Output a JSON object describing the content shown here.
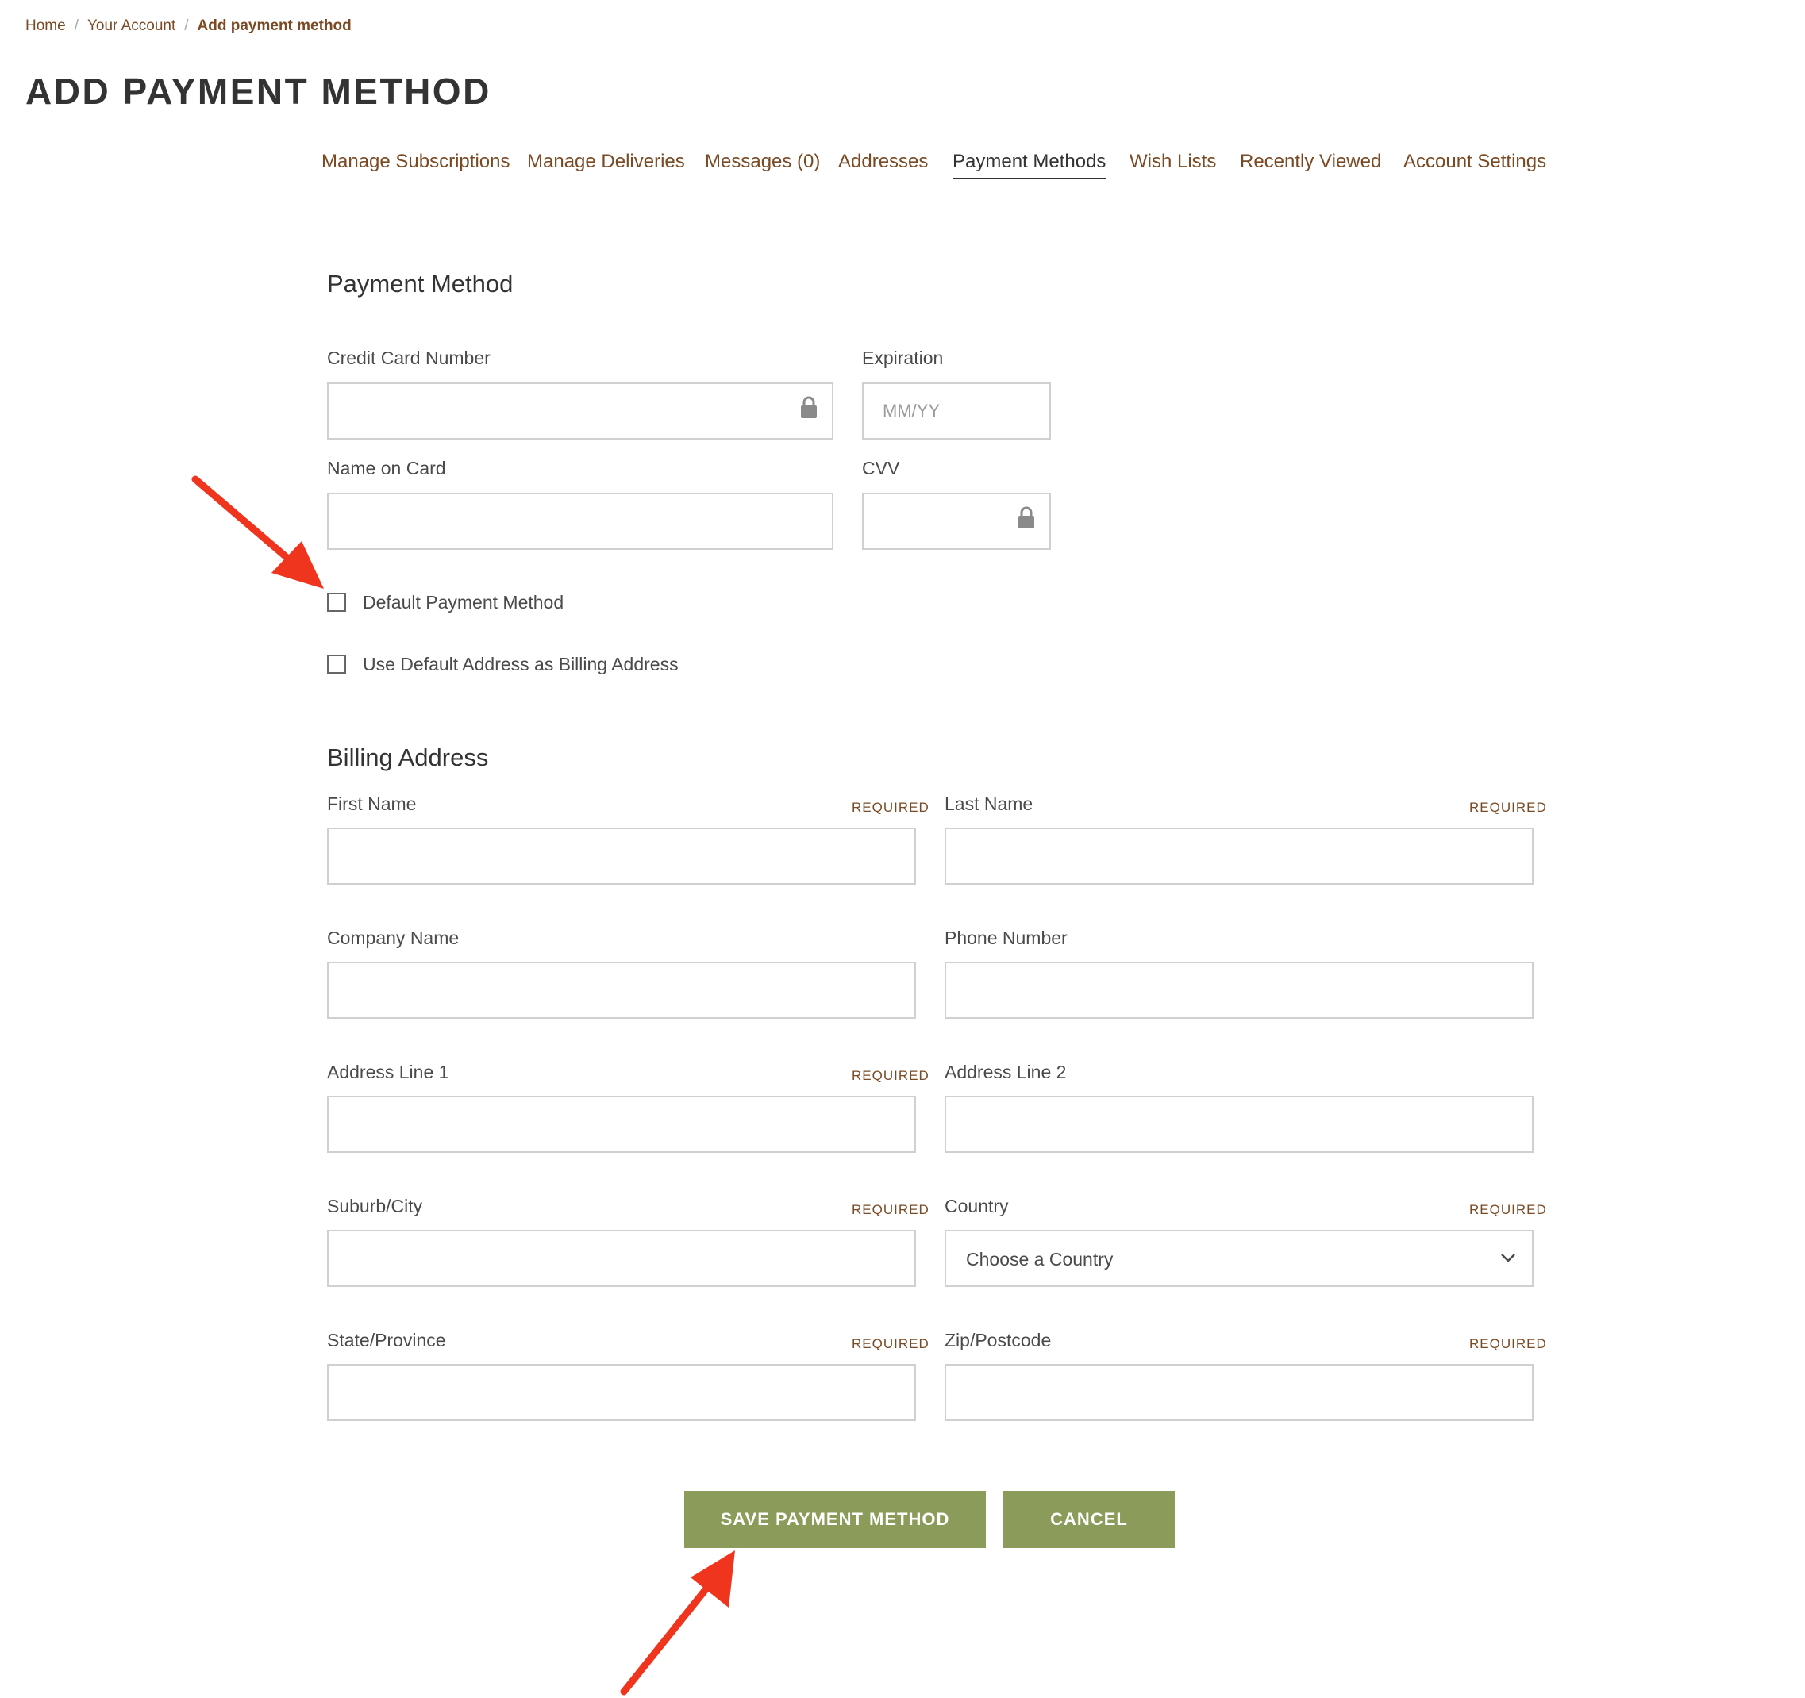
{
  "breadcrumb": {
    "home": "Home",
    "account": "Your Account",
    "current": "Add payment method",
    "separator": "/"
  },
  "page_title": "ADD PAYMENT METHOD",
  "nav": {
    "items": [
      {
        "label": "Manage Subscriptions"
      },
      {
        "label": "Manage Deliveries"
      },
      {
        "label": "Messages (0)"
      },
      {
        "label": "Addresses"
      },
      {
        "label": "Payment Methods",
        "active": true
      },
      {
        "label": "Wish Lists"
      },
      {
        "label": "Recently Viewed"
      },
      {
        "label": "Account Settings"
      }
    ]
  },
  "payment": {
    "title": "Payment Method",
    "card_number_label": "Credit Card Number",
    "card_number_value": "",
    "expiration_label": "Expiration",
    "expiration_placeholder": "MM/YY",
    "name_label": "Name on Card",
    "name_value": "",
    "cvv_label": "CVV",
    "cvv_value": "",
    "default_payment_label": "Default Payment Method",
    "default_payment_checked": false,
    "use_default_address_label": "Use Default Address as Billing Address",
    "use_default_address_checked": false
  },
  "billing": {
    "title": "Billing Address",
    "required_text": "REQUIRED",
    "first_name_label": "First Name",
    "last_name_label": "Last Name",
    "company_label": "Company Name",
    "phone_label": "Phone Number",
    "address1_label": "Address Line 1",
    "address2_label": "Address Line 2",
    "city_label": "Suburb/City",
    "country_label": "Country",
    "country_selected": "Choose a Country",
    "state_label": "State/Province",
    "zip_label": "Zip/Postcode"
  },
  "buttons": {
    "save": "SAVE PAYMENT METHOD",
    "cancel": "CANCEL"
  },
  "colors": {
    "accent_brown": "#7a4a24",
    "button_green": "#8b9c5a",
    "annotation_red": "#f0351f"
  }
}
